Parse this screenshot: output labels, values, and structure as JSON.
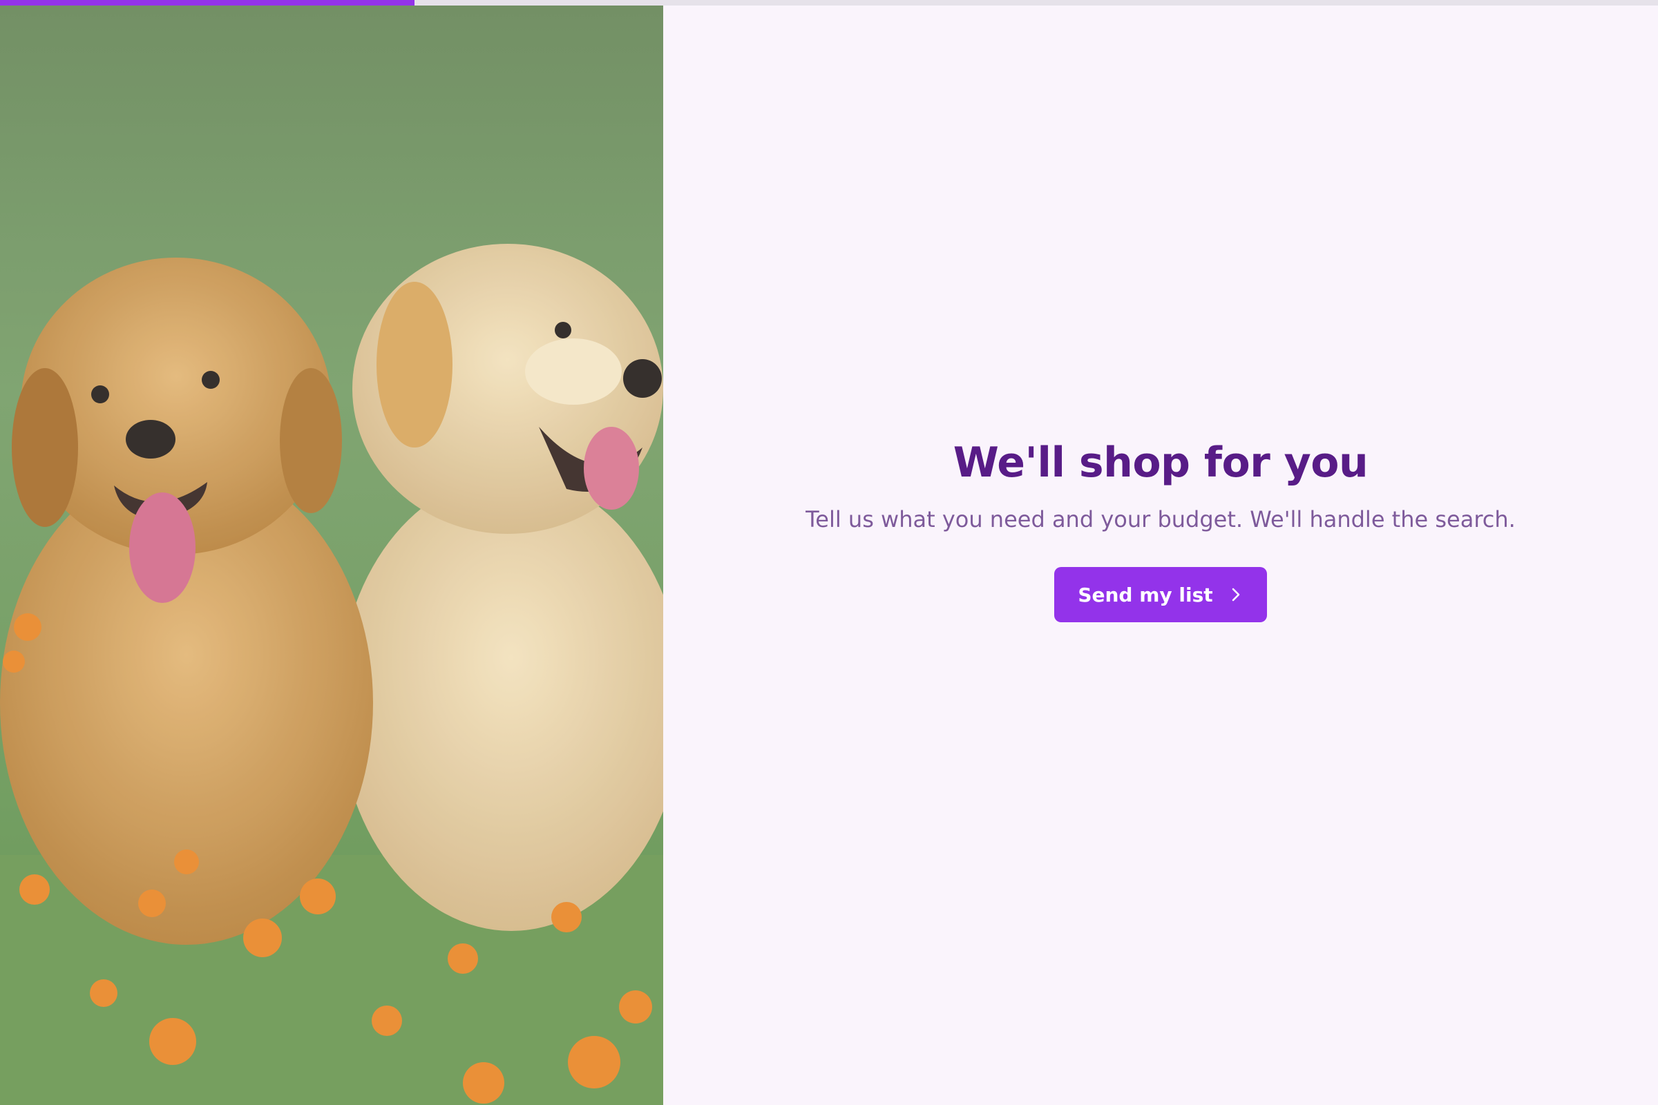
{
  "progress": {
    "value": 0.25,
    "color": "#9333ea"
  },
  "hero": {
    "image": "two-golden-retriever-puppies-on-grass"
  },
  "main": {
    "title": "We'll shop for you",
    "subtitle": "Tell us what you need and your budget. We'll handle the search.",
    "cta_label": "Send my list",
    "cta_icon": "chevron-right-icon"
  },
  "colors": {
    "accent": "#9333ea",
    "title": "#581c87",
    "subtitle": "#7e5a9b",
    "background": "#faf4fc"
  }
}
